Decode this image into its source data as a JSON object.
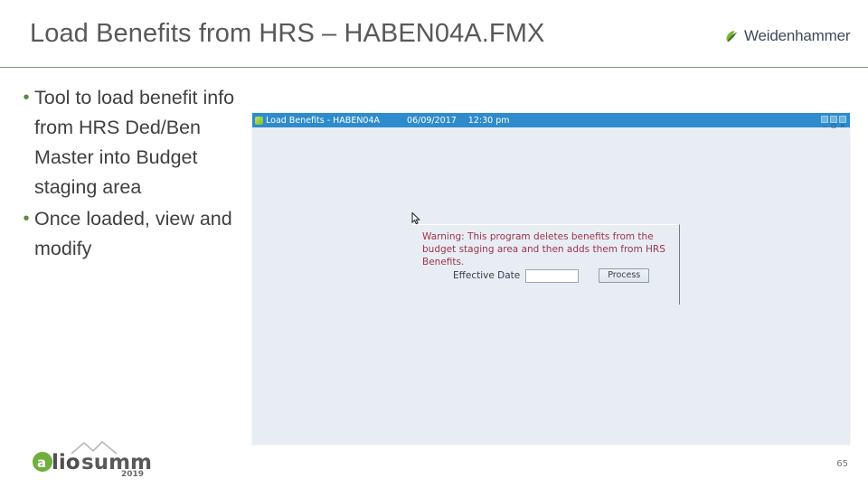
{
  "slide": {
    "title": "Load Benefits from HRS – HABEN04A.FMX",
    "page_number": "65",
    "accent_green": "#7c9a63",
    "title_color": "#595959"
  },
  "brand": {
    "name": "Weidenhammer",
    "mark_icon": "leaf-swoosh-icon",
    "mark_color": "#7fb539"
  },
  "bullets": [
    {
      "marker": "•",
      "text": "Tool to load benefit info from HRS Ded/Ben Master into Budget staging area"
    },
    {
      "marker": "•",
      "text": "Once loaded, view and modify"
    }
  ],
  "app_window": {
    "titlebar": {
      "icon": "app-document-icon",
      "title": "Load Benefits - HABEN04A",
      "date": "06/09/2017",
      "time": "12:30 pm",
      "bg_color": "#2e8ccc",
      "buttons": [
        {
          "name": "minimize",
          "glyph": "–"
        },
        {
          "name": "maximize",
          "glyph": "□"
        },
        {
          "name": "close",
          "glyph": "✕"
        }
      ]
    },
    "body_color": "#e8edf4",
    "dialog": {
      "warning": "Warning: This program deletes benefits from the budget staging area and then adds them from HRS Benefits.",
      "warning_color": "#9e3347",
      "effective_date_label": "Effective Date",
      "effective_date_value": "",
      "effective_date_placeholder": "",
      "process_button": "Process"
    },
    "cursor_icon": "mouse-pointer-icon"
  },
  "footer": {
    "logo": {
      "word_one": "lio",
      "word_two": "summit",
      "year": "2019",
      "mark_icon": "alio-circle-a-icon",
      "mountain_icon": "mountain-outline-icon"
    }
  }
}
